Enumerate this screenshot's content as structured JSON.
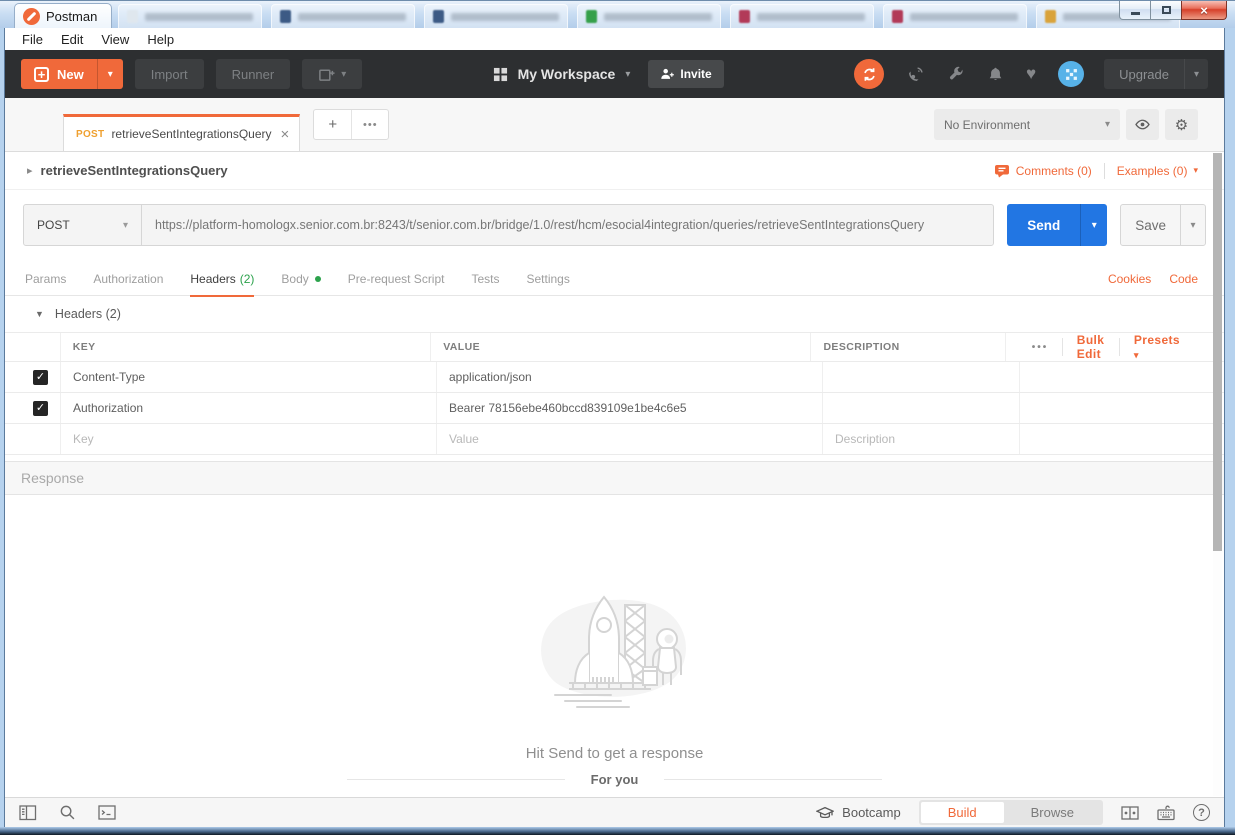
{
  "icons": {
    "more": "•••",
    "chevron_down": "▾",
    "close_x": "×",
    "caret_right": "▸",
    "caret_down": "▼",
    "gear": "⚙",
    "heart": "♥",
    "check": "✓",
    "plus": "+",
    "question": "?"
  },
  "window": {
    "app_title": "Postman"
  },
  "menubar": {
    "items": [
      {
        "label": "File"
      },
      {
        "label": "Edit"
      },
      {
        "label": "View"
      },
      {
        "label": "Help"
      }
    ]
  },
  "toolbar": {
    "new_button": "New",
    "import_button": "Import",
    "runner_button": "Runner",
    "workspace": "My Workspace",
    "invite_button": "Invite",
    "upgrade_button": "Upgrade"
  },
  "tab_strip": {
    "active_tab_method": "POST",
    "active_tab_title": "retrieveSentIntegrationsQuery",
    "environment": "No Environment"
  },
  "request": {
    "name": "retrieveSentIntegrationsQuery",
    "comments": "Comments (0)",
    "examples": "Examples (0)",
    "method": "POST",
    "url": "https://platform-homologx.senior.com.br:8243/t/senior.com.br/bridge/1.0/rest/hcm/esocial4integration/queries/retrieveSentIntegrationsQuery",
    "send": "Send",
    "save": "Save",
    "cookies": "Cookies",
    "code": "Code",
    "tabs": [
      {
        "label": "Params"
      },
      {
        "label": "Authorization"
      },
      {
        "label": "Headers",
        "badge": "(2)"
      },
      {
        "label": "Body"
      },
      {
        "label": "Pre-request Script"
      },
      {
        "label": "Tests"
      },
      {
        "label": "Settings"
      }
    ]
  },
  "headers_editor": {
    "section_title": "Headers (2)",
    "col_key": "KEY",
    "col_value": "VALUE",
    "col_description": "DESCRIPTION",
    "bulk_edit": "Bulk Edit",
    "presets": "Presets",
    "rows": [
      {
        "key": "Content-Type",
        "value": "application/json"
      },
      {
        "key": "Authorization",
        "value": "Bearer 78156ebe460bccd839109e1be4c6e5"
      }
    ],
    "placeholder_key": "Key",
    "placeholder_value": "Value",
    "placeholder_description": "Description"
  },
  "response": {
    "title": "Response",
    "empty_message": "Hit Send to get a response",
    "divider_label": "For you"
  },
  "status_bar": {
    "bootcamp": "Bootcamp",
    "build": "Build",
    "browse": "Browse"
  },
  "colors": {
    "accent_orange": "#f0693a",
    "send_blue": "#2276e3",
    "success_green": "#2ca24c",
    "toolbar_dark": "#2d2f31",
    "method_post_badge": "#efa02f"
  }
}
